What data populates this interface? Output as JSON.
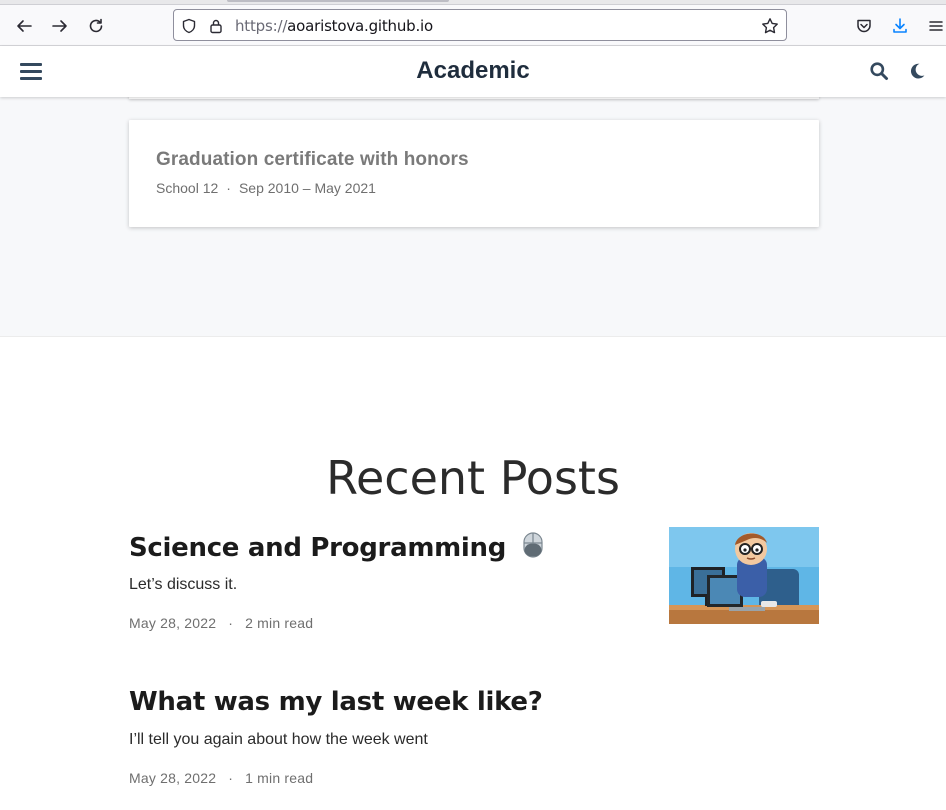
{
  "browser": {
    "url_scheme": "https://",
    "url_host": "aoaristova.github.io"
  },
  "navbar": {
    "title": "Academic"
  },
  "experience": {
    "card": {
      "title": "Graduation certificate with honors",
      "organization": "School 12",
      "separator": "·",
      "period": "Sep 2010 – May 2021"
    }
  },
  "recent_posts": {
    "heading": "Recent Posts",
    "posts": [
      {
        "title": "Science and Programming",
        "title_icon": "computer-mouse-icon",
        "summary": "Let’s discuss it.",
        "date": "May 28, 2022",
        "separator": "·",
        "read_time": "2 min read",
        "thumbnail": "cartoon-programmer-at-computer-image"
      },
      {
        "title": "What was my last week like?",
        "summary": "I’ll tell you again about how the week went",
        "date": "May 28, 2022",
        "separator": "·",
        "read_time": "1 min read"
      }
    ]
  },
  "colors": {
    "navbar_title": "#1f2d3d",
    "card_title": "#7a7a7a",
    "section_bg": "#f7f8fa",
    "download_icon": "#0a84ff"
  }
}
